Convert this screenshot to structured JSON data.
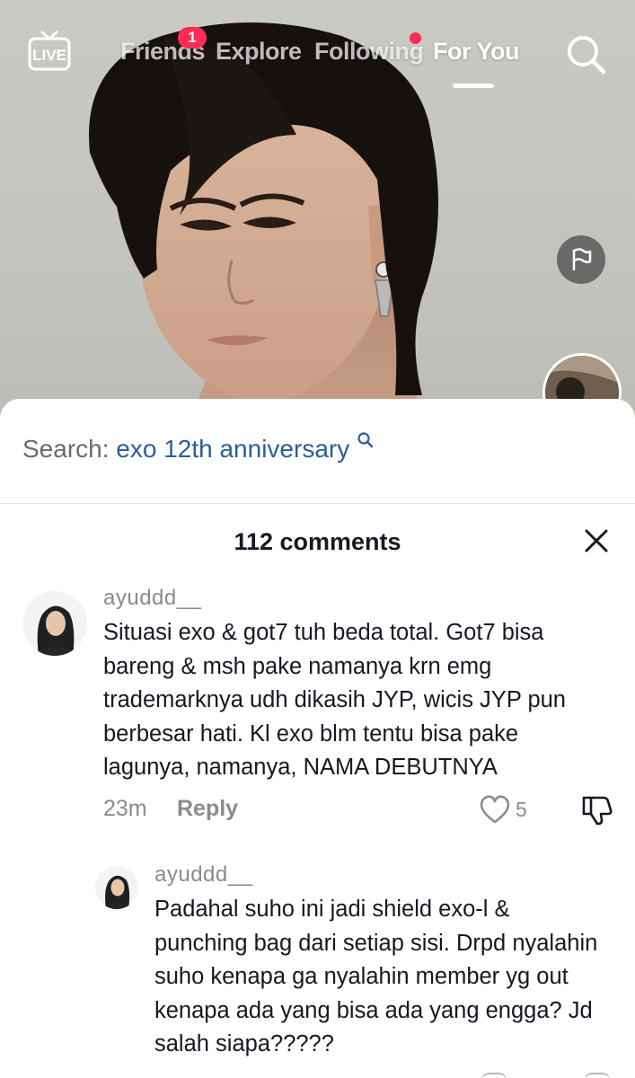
{
  "nav": {
    "live_label": "LIVE",
    "tabs": [
      {
        "label": "Friends",
        "badge": "1"
      },
      {
        "label": "Explore"
      },
      {
        "label": "Following",
        "has_dot": true
      },
      {
        "label": "For You",
        "active": true
      }
    ]
  },
  "search_bar": {
    "prefix": "Search:",
    "query": "exo 12th anniversary"
  },
  "comments": {
    "title": "112 comments",
    "items": [
      {
        "username": "ayuddd__",
        "text": "Situasi exo & got7 tuh beda total. Got7 bisa bareng & msh pake namanya krn emg trademarknya udh dikasih JYP, wicis JYP pun berbesar hati. Kl exo blm tentu bisa pake lagunya, namanya, NAMA DEBUTNYA",
        "time": "23m",
        "reply_label": "Reply",
        "likes": "5"
      },
      {
        "username": "ayuddd__",
        "text": "Padahal suho ini jadi shield exo-l & punching bag dari setiap sisi. Drpd nyalahin suho kenapa ga nyalahin member yg out kenapa ada yang bisa ada yang engga? Jd salah siapa?????"
      }
    ]
  },
  "colors": {
    "accent": "#fe2c55",
    "search_link": "#2b5d9c",
    "muted_text": "#8a8b91",
    "primary_text": "#161823"
  }
}
